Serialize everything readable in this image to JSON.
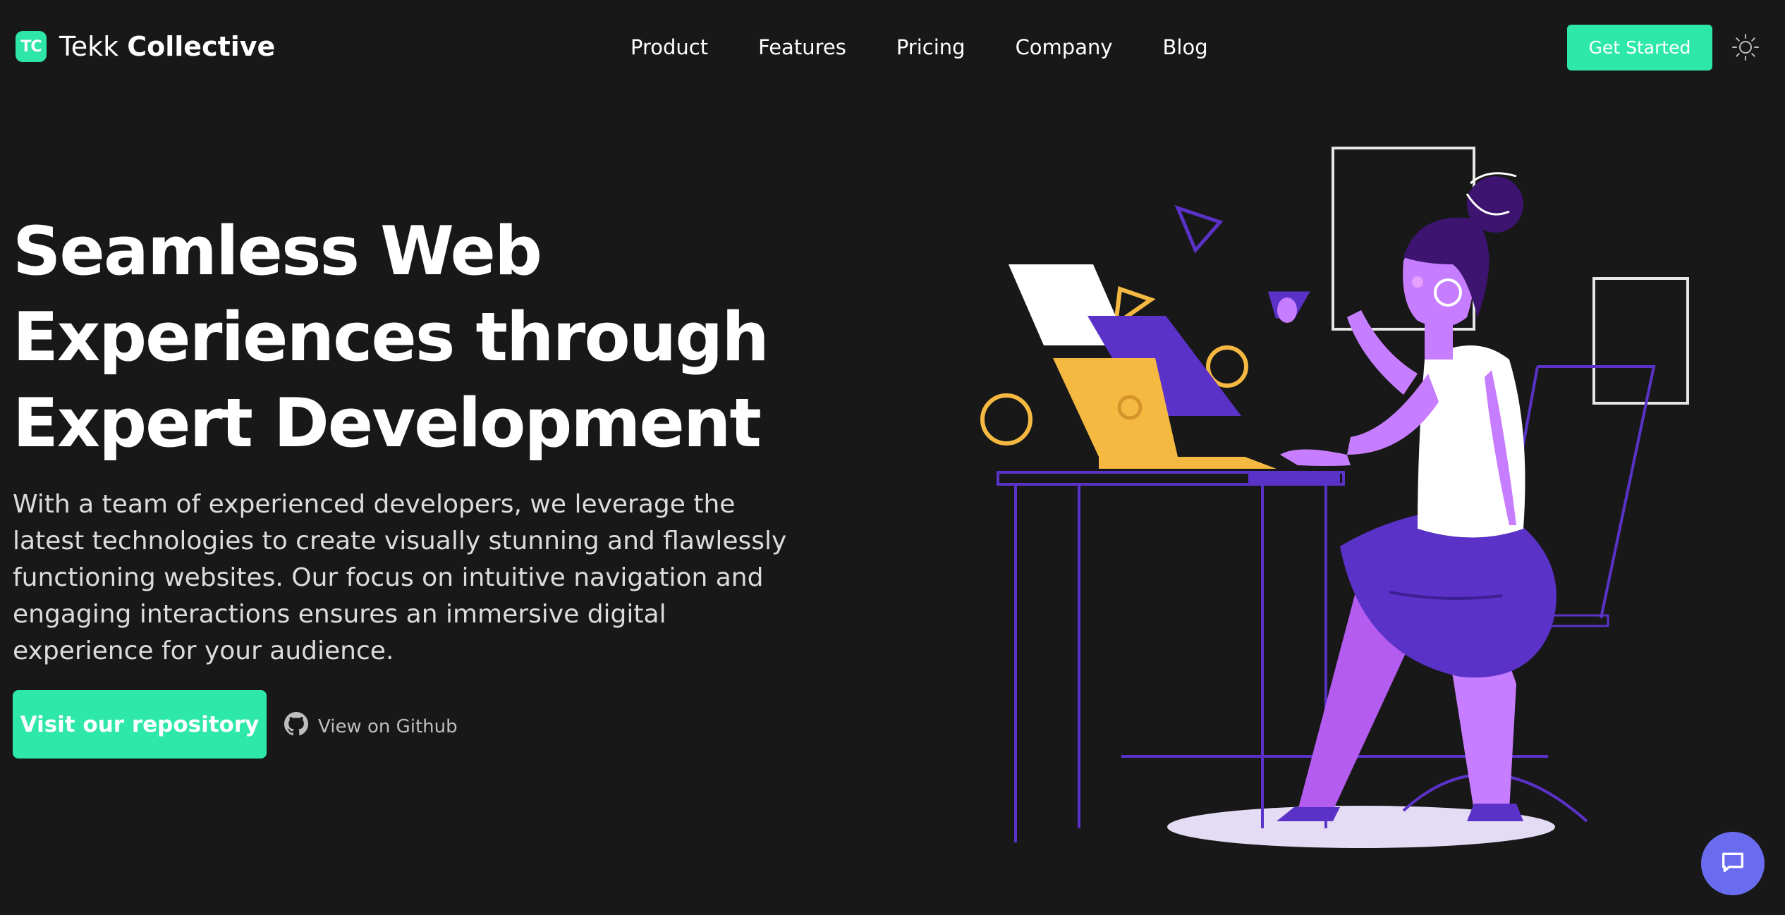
{
  "brand": {
    "mark": "TC",
    "name_light": "Tekk",
    "name_bold": "Collective",
    "accent_color": "#2ee8aa"
  },
  "nav": {
    "links": [
      "Product",
      "Features",
      "Pricing",
      "Company",
      "Blog"
    ]
  },
  "header": {
    "cta_label": "Get Started",
    "theme_icon": "sun-icon"
  },
  "hero": {
    "title_line1": "Seamless Web",
    "title_line2": "Experiences through",
    "title_line3": "Expert Development",
    "description": "With a team of experienced developers, we leverage the latest technologies to create visually stunning and flawlessly functioning websites. Our focus on intuitive navigation and engaging interactions ensures an immersive digital experience for your audience.",
    "primary_button": "Visit our repository",
    "secondary_link": "View on Github",
    "secondary_icon": "github-icon"
  },
  "illustration": {
    "subject": "woman-at-laptop-illustration",
    "colors": {
      "purple_dark": "#5a32c8",
      "purple_light": "#c77dff",
      "yellow": "#f5b942",
      "white": "#ffffff"
    }
  },
  "chat": {
    "icon": "chat-icon",
    "color": "#6a6cf0"
  }
}
